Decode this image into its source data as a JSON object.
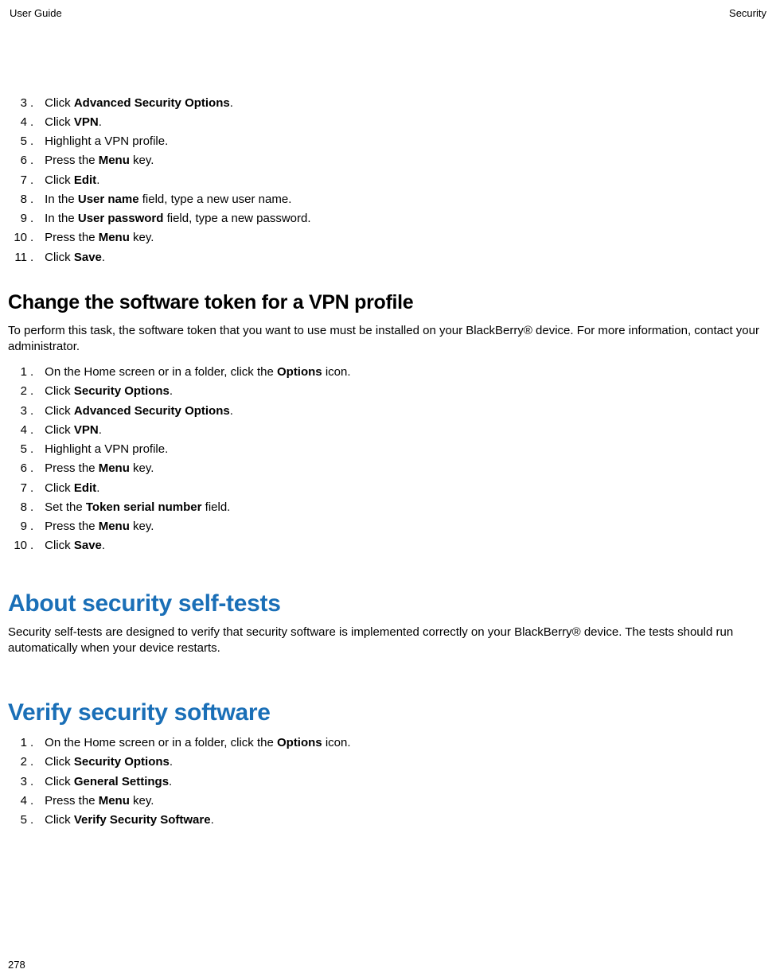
{
  "header": {
    "left": "User Guide",
    "right": "Security"
  },
  "page_number": "278",
  "list1": {
    "start": 3,
    "items": [
      [
        [
          "Click "
        ],
        [
          "b",
          "Advanced Security Options"
        ],
        [
          "."
        ]
      ],
      [
        [
          "Click "
        ],
        [
          "b",
          "VPN"
        ],
        [
          "."
        ]
      ],
      [
        [
          "Highlight a VPN profile."
        ]
      ],
      [
        [
          "Press the "
        ],
        [
          "b",
          "Menu"
        ],
        [
          " key."
        ]
      ],
      [
        [
          "Click "
        ],
        [
          "b",
          "Edit"
        ],
        [
          "."
        ]
      ],
      [
        [
          "In the "
        ],
        [
          "b",
          "User name"
        ],
        [
          " field, type a new user name."
        ]
      ],
      [
        [
          "In the "
        ],
        [
          "b",
          "User password"
        ],
        [
          " field, type a new password."
        ]
      ],
      [
        [
          "Press the "
        ],
        [
          "b",
          "Menu"
        ],
        [
          " key."
        ]
      ],
      [
        [
          "Click "
        ],
        [
          "b",
          "Save"
        ],
        [
          "."
        ]
      ]
    ]
  },
  "section2": {
    "heading": "Change the software token for a VPN profile",
    "intro": "To perform this task, the software token that you want to use must be installed on your BlackBerry® device. For more information, contact your administrator.",
    "list": {
      "start": 1,
      "items": [
        [
          [
            "On the Home screen or in a folder, click the "
          ],
          [
            "b",
            "Options"
          ],
          [
            " icon."
          ]
        ],
        [
          [
            "Click "
          ],
          [
            "b",
            "Security Options"
          ],
          [
            "."
          ]
        ],
        [
          [
            "Click "
          ],
          [
            "b",
            "Advanced Security Options"
          ],
          [
            "."
          ]
        ],
        [
          [
            "Click "
          ],
          [
            "b",
            "VPN"
          ],
          [
            "."
          ]
        ],
        [
          [
            "Highlight a VPN profile."
          ]
        ],
        [
          [
            "Press the "
          ],
          [
            "b",
            "Menu"
          ],
          [
            " key."
          ]
        ],
        [
          [
            "Click "
          ],
          [
            "b",
            "Edit"
          ],
          [
            "."
          ]
        ],
        [
          [
            "Set the "
          ],
          [
            "b",
            "Token serial number"
          ],
          [
            " field."
          ]
        ],
        [
          [
            "Press the "
          ],
          [
            "b",
            "Menu"
          ],
          [
            " key."
          ]
        ],
        [
          [
            "Click "
          ],
          [
            "b",
            "Save"
          ],
          [
            "."
          ]
        ]
      ]
    }
  },
  "section3": {
    "heading": "About security self-tests",
    "body": "Security self-tests are designed to verify that security software is implemented correctly on your BlackBerry® device. The tests should run automatically when your device restarts."
  },
  "section4": {
    "heading": "Verify security software",
    "list": {
      "start": 1,
      "items": [
        [
          [
            "On the Home screen or in a folder, click the "
          ],
          [
            "b",
            "Options"
          ],
          [
            " icon."
          ]
        ],
        [
          [
            "Click "
          ],
          [
            "b",
            "Security Options"
          ],
          [
            "."
          ]
        ],
        [
          [
            "Click "
          ],
          [
            "b",
            "General Settings"
          ],
          [
            "."
          ]
        ],
        [
          [
            "Press the "
          ],
          [
            "b",
            "Menu"
          ],
          [
            " key."
          ]
        ],
        [
          [
            "Click "
          ],
          [
            "b",
            "Verify Security Software"
          ],
          [
            "."
          ]
        ]
      ]
    }
  }
}
